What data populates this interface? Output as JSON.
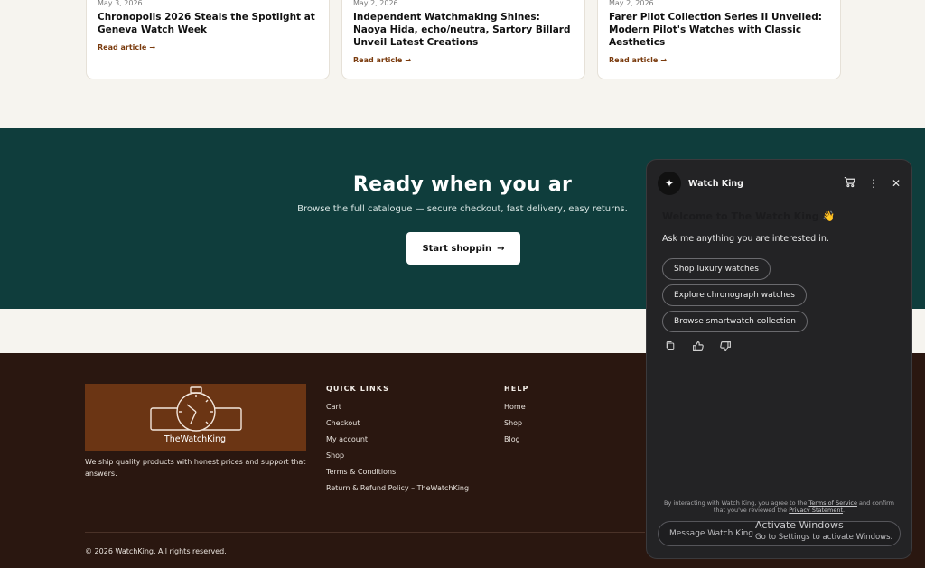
{
  "articles": [
    {
      "date": "May 3, 2026",
      "title": "Chronopolis 2026 Steals the Spotlight at Geneva Watch Week",
      "read": "Read article"
    },
    {
      "date": "May 2, 2026",
      "title": "Independent Watchmaking Shines: Naoya Hida, echo/neutra, Sartory Billard Unveil Latest Creations",
      "read": "Read article"
    },
    {
      "date": "May 2, 2026",
      "title": "Farer Pilot Collection Series II Unveiled: Modern Pilot's Watches with Classic Aesthetics",
      "read": "Read article"
    }
  ],
  "cta": {
    "headline": "Ready when you ar",
    "sub": "Browse the full catalogue — secure checkout, fast delivery, easy returns.",
    "button": "Start shoppin"
  },
  "footer": {
    "logo_text": "TheWatchKing",
    "tagline": "We ship quality products with honest prices and support that answers.",
    "quick_links_title": "QUICK LINKS",
    "quick_links": [
      "Cart",
      "Checkout",
      "My account",
      "Shop",
      "Terms & Conditions",
      "Return & Refund Policy – TheWatchKing"
    ],
    "help_title": "HELP",
    "help_links": [
      "Home",
      "Shop",
      "Blog"
    ],
    "copyright": "© 2026 WatchKing. All rights reserved."
  },
  "chat": {
    "name": "Watch King",
    "welcome": "Welcome to The Watch King",
    "wave": "👋",
    "ask": "Ask me anything you are interested in.",
    "chips": [
      "Shop luxury watches",
      "Explore chronograph watches",
      "Browse smartwatch collection"
    ],
    "legal_prefix": "By interacting with Watch King, you agree to the ",
    "legal_terms": "Terms of Service",
    "legal_mid": " and confirm that you've reviewed the ",
    "legal_privacy": "Privacy Statement",
    "legal_end": ".",
    "input_placeholder": "Message Watch King"
  },
  "os_overlay": {
    "title": "Activate Windows",
    "sub": "Go to Settings to activate Windows."
  },
  "colors": {
    "cta_bg": "#0f3d3c",
    "footer_bg": "#2a1710",
    "logo_bg": "#6b3514",
    "accent": "#7a3b0e",
    "chat_bg": "#232325"
  }
}
